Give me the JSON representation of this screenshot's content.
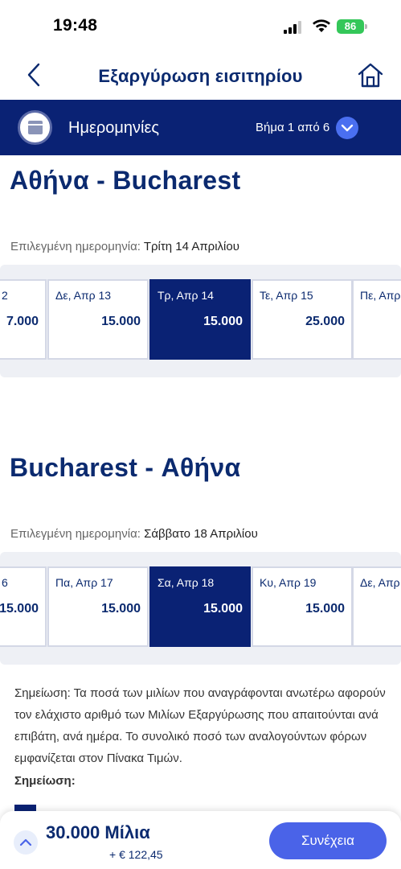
{
  "status": {
    "time": "19:48",
    "battery": "86"
  },
  "header": {
    "title": "Εξαργύρωση εισιτηρίου"
  },
  "step": {
    "title": "Ημερομηνίες",
    "counter": "Βήμα 1 από 6"
  },
  "outbound": {
    "route": "Αθήνα - Bucharest",
    "selected_label": "Επιλεγμένη ημερομηνία:",
    "selected_value": "Τρίτη 14 Απριλίου",
    "dates": [
      {
        "label": "2",
        "miles": "7.000"
      },
      {
        "label": "Δε, Απρ 13",
        "miles": "15.000"
      },
      {
        "label": "Τρ, Απρ 14",
        "miles": "15.000"
      },
      {
        "label": "Τε, Απρ 15",
        "miles": "25.000"
      },
      {
        "label": "Πε, Απρ",
        "miles": ""
      }
    ]
  },
  "inbound": {
    "route": "Bucharest - Αθήνα",
    "selected_label": "Επιλεγμένη ημερομηνία:",
    "selected_value": "Σάββατο 18 Απριλίου",
    "dates": [
      {
        "label": "6",
        "miles": "15.000"
      },
      {
        "label": "Πα, Απρ 17",
        "miles": "15.000"
      },
      {
        "label": "Σα, Απρ 18",
        "miles": "15.000"
      },
      {
        "label": "Κυ, Απρ 19",
        "miles": "15.000"
      },
      {
        "label": "Δε, Απρ",
        "miles": ""
      }
    ]
  },
  "notes": {
    "text": "Σημείωση: Τα ποσά των μιλίων που αναγράφονται ανωτέρω αφορούν τον ελάχιστο αριθμό των Μιλίων Εξαργύρωσης που απαιτούνται ανά επιβάτη, ανά ημέρα. Το συνολικό ποσό των αναλογούντων φόρων εμφανίζεται στον Πίνακα Τιμών.",
    "label": "Σημείωση:"
  },
  "summary": {
    "miles": "30.000 Μίλια",
    "fees": "+ € 122,45",
    "continue_label": "Συνέχεια"
  },
  "colors": {
    "navy": "#0a2274",
    "accent": "#4a63e8",
    "battery": "#34c759"
  },
  "icons": [
    "back-chevron-icon",
    "home-icon",
    "calendar-icon",
    "chevron-down-icon",
    "chevron-up-icon",
    "signal-icon",
    "wifi-icon",
    "battery-icon"
  ]
}
